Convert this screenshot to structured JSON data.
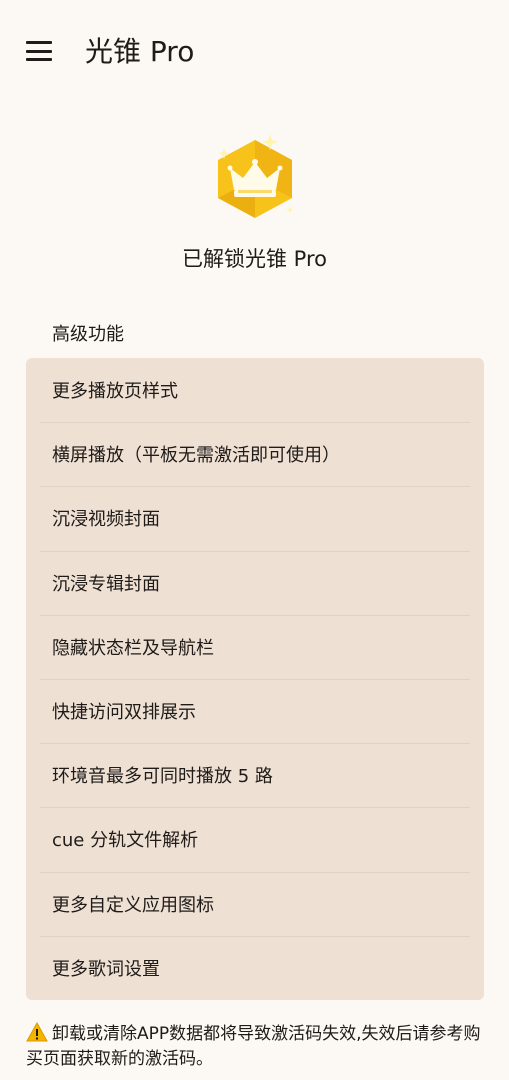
{
  "appbar": {
    "title": "光锥 Pro",
    "menu_icon": "hamburger-menu-icon"
  },
  "badge": {
    "icon": "crown-badge-icon",
    "colors": {
      "primary": "#f7c31b",
      "shade": "#e6a80c",
      "highlight": "#fff3b0"
    }
  },
  "status_text": "已解锁光锥 Pro",
  "features": {
    "header": "高级功能",
    "items": [
      "更多播放页样式",
      "横屏播放（平板无需激活即可使用）",
      "沉浸视频封面",
      "沉浸专辑封面",
      "隐藏状态栏及导航栏",
      "快捷访问双排展示",
      "环境音最多可同时播放 5 路",
      "cue 分轨文件解析",
      "更多自定义应用图标",
      "更多歌词设置"
    ]
  },
  "notice": {
    "icon": "warning-icon",
    "text": "卸载或清除APP数据都将导致激活码失效,失效后请参考购买页面获取新的激活码。"
  },
  "colors": {
    "background": "#fcf8f4",
    "card": "#efe0d4",
    "divider": "#e2d2c5",
    "text": "#1e1b18"
  }
}
